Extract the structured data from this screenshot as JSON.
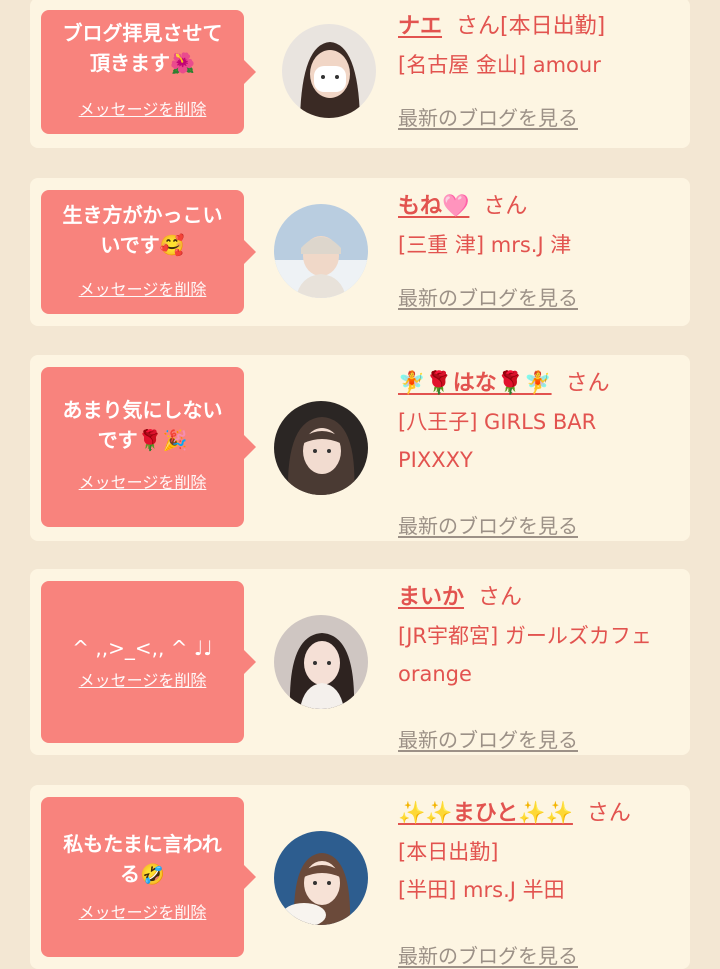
{
  "delete_label": "メッセージを削除",
  "blog_label": "最新のブログを見る",
  "san_label": "さん",
  "cards": [
    {
      "message_line1": "ブログ拝見させて",
      "message_line2": "頂きます🌺",
      "name": "ナエ",
      "name_suffix": "[本日出勤]",
      "line1": "[名古屋 金山] amour",
      "line2": "",
      "avatar_icon": "avatar-photo"
    },
    {
      "message_line1": "生き方がかっこい",
      "message_line2": "いです🥰",
      "name": "もね🩷",
      "name_suffix": "",
      "line1": "[三重 津] mrs.J 津",
      "line2": "",
      "avatar_icon": "avatar-photo"
    },
    {
      "message_line1": "あまり気にしない",
      "message_line2": "です🌹🎉",
      "name": "🧚🌹はな🌹🧚",
      "name_suffix": "",
      "line1": "[八王子] GIRLS BAR",
      "line2": "PIXXXY",
      "avatar_icon": "avatar-photo"
    },
    {
      "message_line1": "^ ,,>_<,, ^ ♩♩",
      "message_line2": "",
      "name": "まいか",
      "name_suffix": "",
      "line1": "[JR宇都宮] ガールズカフェ",
      "line2": "orange",
      "avatar_icon": "avatar-photo"
    },
    {
      "message_line1": "私もたまに言われ",
      "message_line2": "る🤣",
      "name": "✨✨まひと✨✨",
      "name_suffix": "",
      "line1": "[本日出勤]",
      "line2": "[半田] mrs.J 半田",
      "avatar_icon": "avatar-photo"
    }
  ],
  "colors": {
    "page_bg": "#f3e7d3",
    "card_bg": "#fdf5e2",
    "bubble": "#f8837d",
    "name_text": "#e2534f",
    "link_gray": "#9c9187"
  }
}
